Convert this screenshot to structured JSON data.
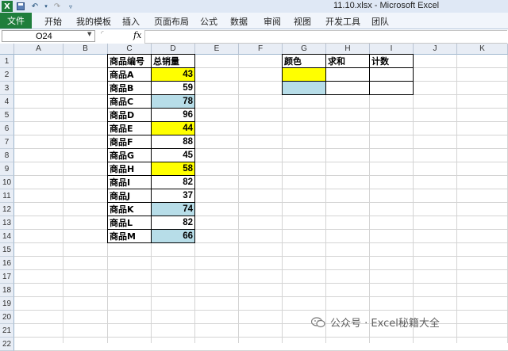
{
  "window": {
    "title": "11.10.xlsx - Microsoft Excel"
  },
  "ribbon": {
    "file_tab": "文件",
    "tabs": [
      "开始",
      "我的模板",
      "插入",
      "页面布局",
      "公式",
      "数据",
      "审阅",
      "视图",
      "开发工具",
      "团队"
    ]
  },
  "formula_bar": {
    "name_box": "O24",
    "fx_label": "fx",
    "content": ""
  },
  "sheet": {
    "columns": [
      "A",
      "B",
      "C",
      "D",
      "E",
      "F",
      "G",
      "H",
      "I",
      "J",
      "K"
    ],
    "rows": [
      "1",
      "2",
      "3",
      "4",
      "5",
      "6",
      "7",
      "8",
      "9",
      "10",
      "11",
      "12",
      "13",
      "14",
      "15",
      "16",
      "17",
      "18",
      "19",
      "20",
      "21",
      "22"
    ],
    "product_table": {
      "header": [
        "商品编号",
        "总销量"
      ],
      "items": [
        {
          "name": "商品A",
          "sales": "43",
          "fill": "#ffff00"
        },
        {
          "name": "商品B",
          "sales": "59",
          "fill": ""
        },
        {
          "name": "商品C",
          "sales": "78",
          "fill": "#b7dde8"
        },
        {
          "name": "商品D",
          "sales": "96",
          "fill": ""
        },
        {
          "name": "商品E",
          "sales": "44",
          "fill": "#ffff00"
        },
        {
          "name": "商品F",
          "sales": "88",
          "fill": ""
        },
        {
          "name": "商品G",
          "sales": "45",
          "fill": ""
        },
        {
          "name": "商品H",
          "sales": "58",
          "fill": "#ffff00"
        },
        {
          "name": "商品I",
          "sales": "82",
          "fill": ""
        },
        {
          "name": "商品J",
          "sales": "37",
          "fill": ""
        },
        {
          "name": "商品K",
          "sales": "74",
          "fill": "#b7dde8"
        },
        {
          "name": "商品L",
          "sales": "82",
          "fill": ""
        },
        {
          "name": "商品M",
          "sales": "66",
          "fill": "#b7dde8"
        }
      ]
    },
    "summary_table": {
      "header": [
        "颜色",
        "求和",
        "计数"
      ],
      "rows": [
        {
          "fill": "#ffff00"
        },
        {
          "fill": "#b7dde8"
        }
      ]
    }
  },
  "watermark": {
    "text": "公众号 · Excel秘籍大全"
  }
}
